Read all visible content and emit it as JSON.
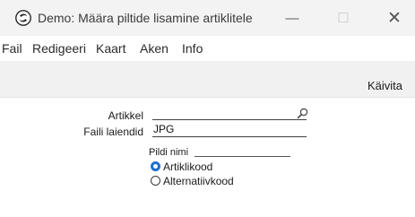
{
  "window": {
    "title": "Demo: Määra piltide lisamine artiklitele",
    "minimize_glyph": "—",
    "maximize_glyph": "☐",
    "close_glyph": "✕"
  },
  "menu": {
    "items": [
      {
        "label": "Fail"
      },
      {
        "label": "Redigeeri"
      },
      {
        "label": "Kaart"
      },
      {
        "label": "Aken"
      },
      {
        "label": "Info"
      }
    ]
  },
  "toolbar": {
    "run_label": "Käivita"
  },
  "form": {
    "artikkel": {
      "label": "Artikkel",
      "value": ""
    },
    "faili_laiendid": {
      "label": "Faili laiendid",
      "value": "JPG"
    },
    "pildi_nimi": {
      "label": "Pildi nimi",
      "options": [
        {
          "label": "Artiklikood",
          "selected": true
        },
        {
          "label": "Alternatiivkood",
          "selected": false
        }
      ]
    }
  },
  "colors": {
    "accent": "#1f6fcf",
    "titlebar": "#f3f3f3",
    "toolbar": "#f1f1f1"
  },
  "icons": [
    "app-icon",
    "magnifier-icon",
    "minimize-icon",
    "maximize-icon",
    "close-icon"
  ]
}
